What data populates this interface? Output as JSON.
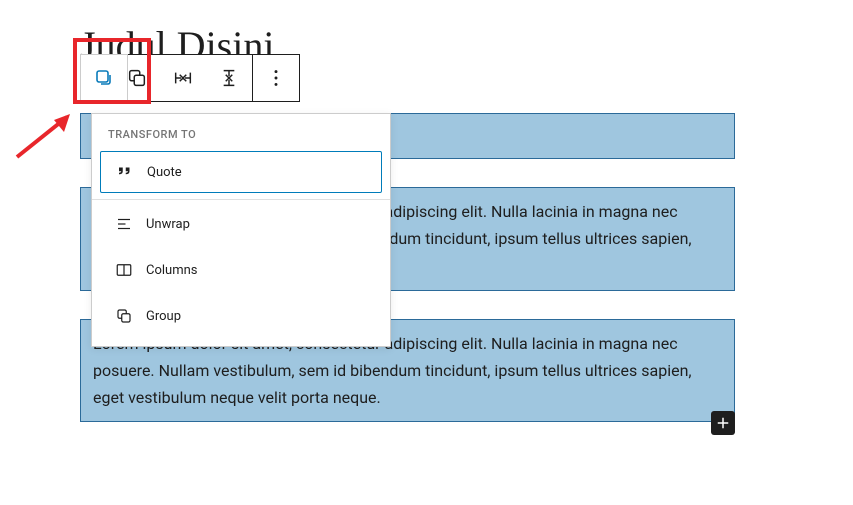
{
  "page": {
    "title": "Judul Disini"
  },
  "toolbar": {
    "icons": {
      "block": "block-icon",
      "group": "group-icon",
      "row": "row-icon",
      "stack": "stack-icon",
      "more": "more-options-icon"
    }
  },
  "dropdown": {
    "header": "TRANSFORM TO",
    "items": [
      {
        "label": "Quote",
        "icon": "quote-icon",
        "selected": true
      },
      {
        "label": "Unwrap",
        "icon": "unwrap-icon",
        "selected": false
      },
      {
        "label": "Columns",
        "icon": "columns-icon",
        "selected": false
      },
      {
        "label": "Group",
        "icon": "group-option-icon",
        "selected": false
      }
    ]
  },
  "paragraphs": [
    "",
    "Lorem ipsum dolor sit amet, consectetur adipiscing elit. Nulla lacinia in magna nec posuere. Nullam vestibulum, sem id bibendum tincidunt, ipsum tellus ultrices sapien, eget vestibulum neque velit porta neque.",
    "Lorem ipsum dolor sit amet, consectetur adipiscing elit. Nulla lacinia in magna nec posuere. Nullam vestibulum, sem id bibendum tincidunt, ipsum tellus ultrices sapien, eget vestibulum neque velit porta neque."
  ],
  "add_button": "+"
}
